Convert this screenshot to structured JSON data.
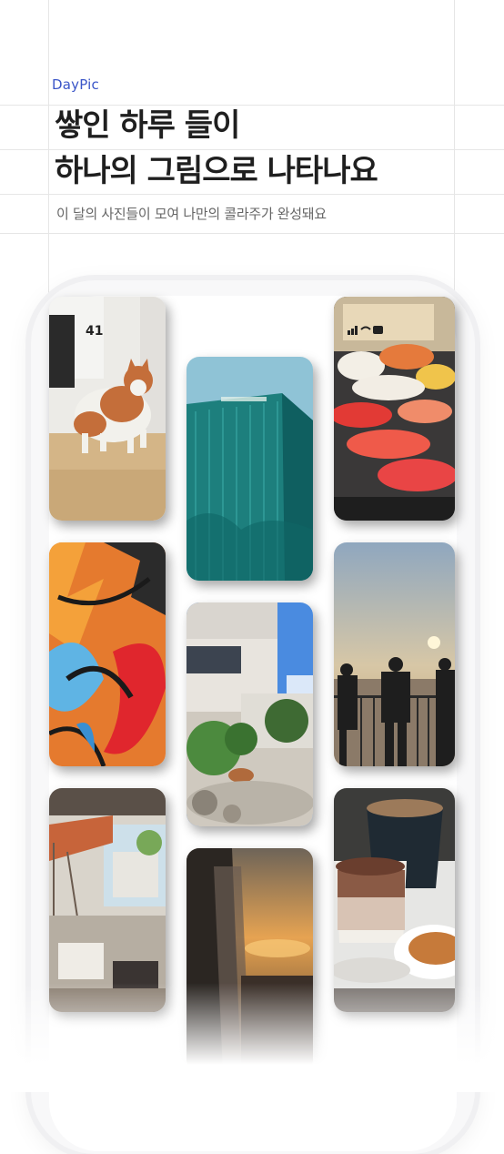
{
  "brand": "DayPic",
  "headline": {
    "line1": "쌓인 하루 들이",
    "line2": "하나의 그림으로 나타나요"
  },
  "subtitle": "이 달의 사진들이 모여 나만의 콜라주가 완성돼요",
  "status_bar": {
    "time": "41"
  },
  "photos": [
    {
      "subject": "cat"
    },
    {
      "subject": "teal-building"
    },
    {
      "subject": "sushi-platter"
    },
    {
      "subject": "graffiti"
    },
    {
      "subject": "courtyard-garden"
    },
    {
      "subject": "sunset-silhouettes"
    },
    {
      "subject": "cafe-interior"
    },
    {
      "subject": "car-window-sunset"
    },
    {
      "subject": "coffee-and-dessert"
    }
  ]
}
